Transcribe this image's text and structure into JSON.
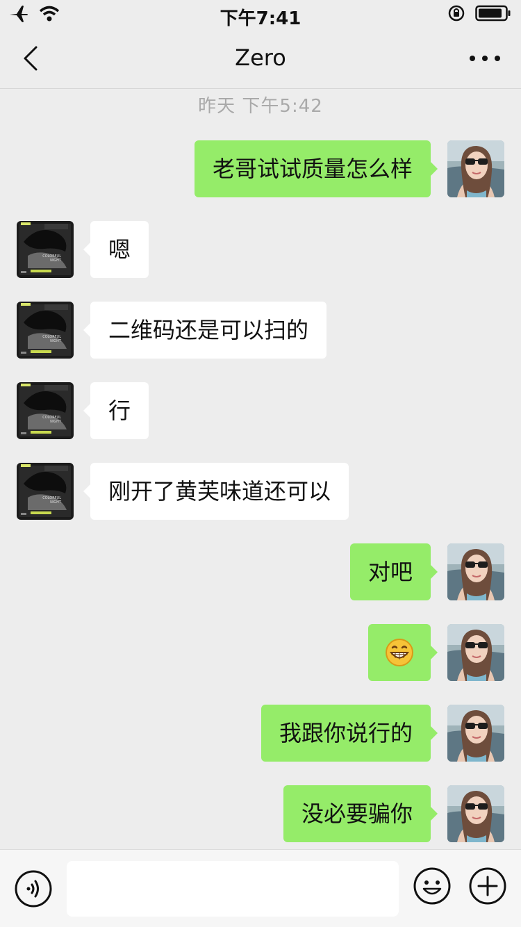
{
  "status_bar": {
    "time": "下午7:41",
    "icons": [
      "airplane-icon",
      "wifi-icon",
      "orientation-lock-icon",
      "battery-icon"
    ]
  },
  "header": {
    "title": "Zero",
    "back_icon": "chevron-left-icon",
    "more_icon": "more-dots-icon"
  },
  "chat": {
    "timestamp": "昨天 下午5:42",
    "messages": [
      {
        "from": "me",
        "text": "老哥试试质量怎么样"
      },
      {
        "from": "them",
        "text": "嗯"
      },
      {
        "from": "them",
        "text": "二维码还是可以扫的"
      },
      {
        "from": "them",
        "text": "行"
      },
      {
        "from": "them",
        "text": "刚开了黄芙味道还可以"
      },
      {
        "from": "me",
        "text": "对吧"
      },
      {
        "from": "me",
        "emoji": "grinning-face-emoji"
      },
      {
        "from": "me",
        "text": "我跟你说行的"
      },
      {
        "from": "me",
        "text": "没必要骗你"
      }
    ]
  },
  "input_bar": {
    "value": "",
    "voice_icon": "voice-icon",
    "emoji_icon": "smiley-icon",
    "plus_icon": "plus-icon"
  },
  "colors": {
    "background": "#ededed",
    "outgoing_bubble": "#95ec69",
    "incoming_bubble": "#ffffff",
    "timestamp_text": "#a9a9a9"
  }
}
